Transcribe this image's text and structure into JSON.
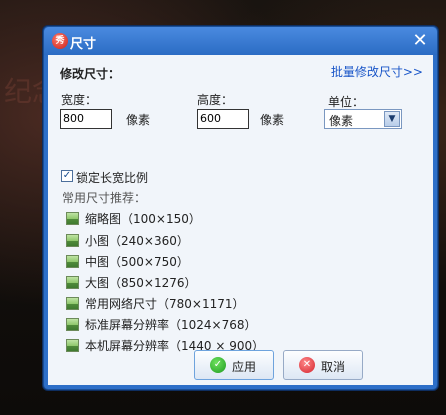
{
  "dialog": {
    "title": "尺寸",
    "close_glyph": "✕",
    "section_title": "修改尺寸：",
    "batch_link": "批量修改尺寸>>"
  },
  "width": {
    "label": "宽度：",
    "value": "800",
    "unit": "像素"
  },
  "height": {
    "label": "高度：",
    "value": "600",
    "unit": "像素"
  },
  "unit": {
    "label": "单位：",
    "selected": "像素"
  },
  "lock_ratio": {
    "label": "锁定长宽比例",
    "checked": true
  },
  "presets_title": "常用尺寸推荐：",
  "presets": [
    {
      "label": "缩略图（100×150）"
    },
    {
      "label": "小图（240×360）"
    },
    {
      "label": "中图（500×750）"
    },
    {
      "label": "大图（850×1276）"
    },
    {
      "label": "常用网络尺寸（780×1171）"
    },
    {
      "label": "标准屏幕分辨率（1024×768）"
    },
    {
      "label": "本机屏幕分辨率（1440 × 900）"
    }
  ],
  "buttons": {
    "ok": "应用",
    "cancel": "取消"
  },
  "background_text": "纪念",
  "icons": {
    "app": "xiu-logo-icon",
    "preset": "picture-icon",
    "ok": "check-circle-icon",
    "cancel": "x-circle-icon"
  },
  "colors": {
    "titlebar": "#2b6cc4",
    "link": "#1a56c8",
    "content_bg": "#f1f5fa"
  }
}
